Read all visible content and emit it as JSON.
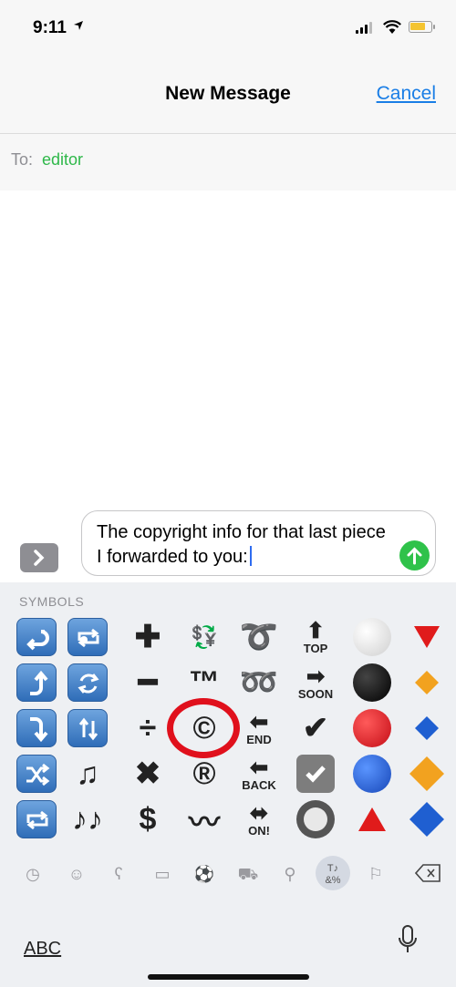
{
  "status": {
    "time": "9:11"
  },
  "nav": {
    "title": "New Message",
    "cancel": "Cancel"
  },
  "to": {
    "label": "To:",
    "value": "editor"
  },
  "message": {
    "text": "The copyright info for that last piece I forwarded to you:"
  },
  "keyboard": {
    "section": "SYMBOLS",
    "abc_label": "ABC",
    "active_category": "symbols",
    "symbols": {
      "tm": "™",
      "copyright": "©",
      "registered": "®",
      "check": "✔",
      "top": "TOP",
      "soon": "SOON",
      "end": "END",
      "back": "BACK",
      "on": "ON!",
      "plus": "✚",
      "minus": "━",
      "divide": "÷",
      "times": "✖",
      "dollar": "$",
      "loop": "➰",
      "double_loop": "➿",
      "note": "♫",
      "notes": "♪♪",
      "wave": "〰",
      "currency": "💱"
    },
    "colors": {
      "red": "#d8121c",
      "black": "#111111",
      "blue": "#1f5fd1",
      "orange": "#f2a21f",
      "white": "#e6e6e6",
      "tile_blue": "#3f7ec8"
    }
  },
  "colors": {
    "accent": "#1a7ee6",
    "green": "#2fb84a",
    "highlight": "#e0101c"
  }
}
